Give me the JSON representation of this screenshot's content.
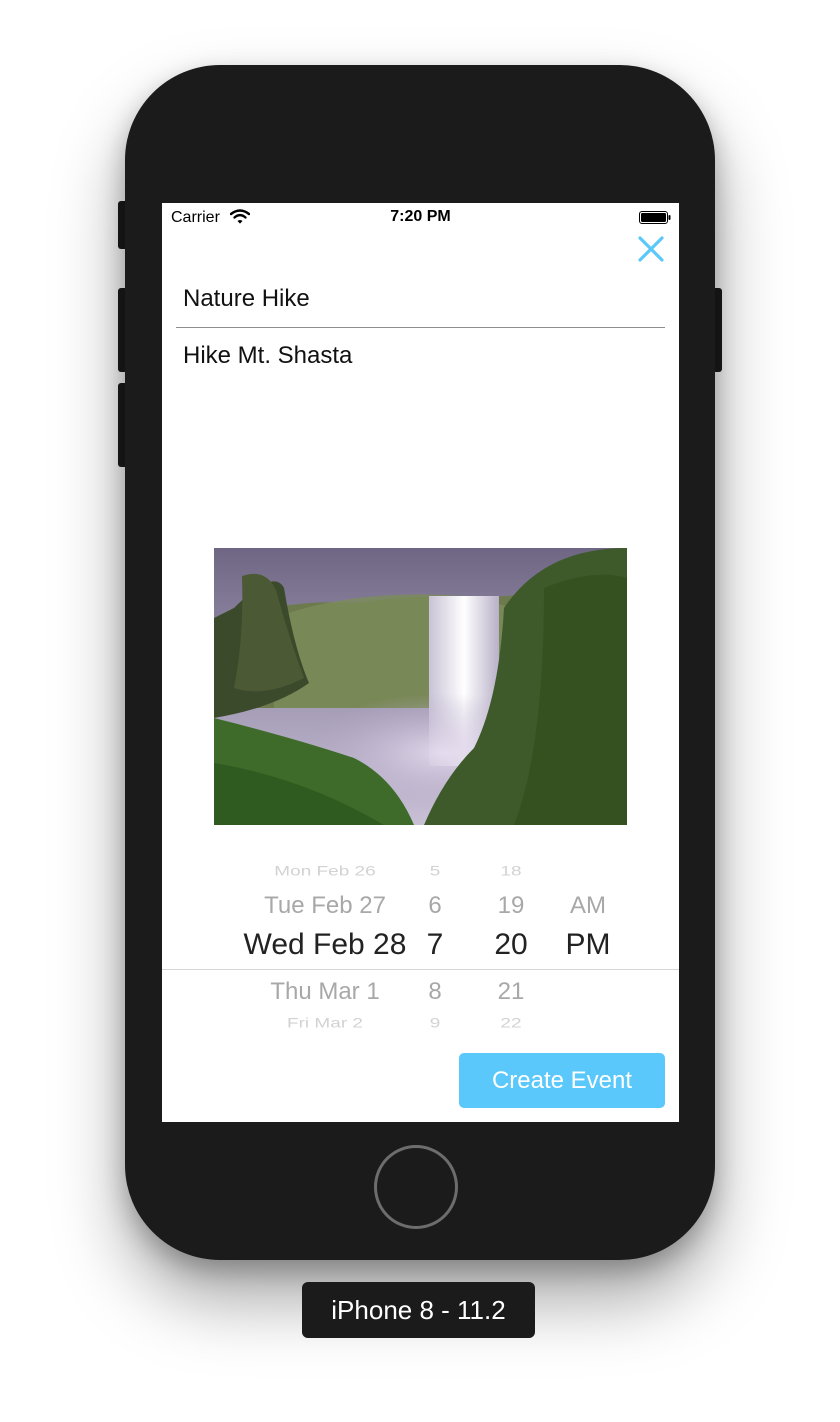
{
  "status_bar": {
    "carrier": "Carrier",
    "time": "7:20 PM"
  },
  "form": {
    "title": "Nature Hike",
    "description": "Hike Mt. Shasta"
  },
  "picker": {
    "dates": [
      "Mon Feb 26",
      "Tue Feb 27",
      "Wed Feb 28",
      "Thu Mar 1",
      "Fri Mar 2"
    ],
    "hours": [
      "5",
      "6",
      "7",
      "8",
      "9"
    ],
    "minutes": [
      "18",
      "19",
      "20",
      "21",
      "22"
    ],
    "periods": [
      "AM",
      "PM"
    ],
    "selected": {
      "date": "Wed Feb 28",
      "hour": "7",
      "minute": "20",
      "period": "PM"
    }
  },
  "buttons": {
    "create_event": "Create Event"
  },
  "device_label": "iPhone 8 - 11.2",
  "colors": {
    "accent": "#5ac8fa",
    "device_body": "#1b1b1b"
  },
  "icons": {
    "close": "close-icon",
    "wifi": "wifi-icon",
    "battery": "battery-icon"
  }
}
